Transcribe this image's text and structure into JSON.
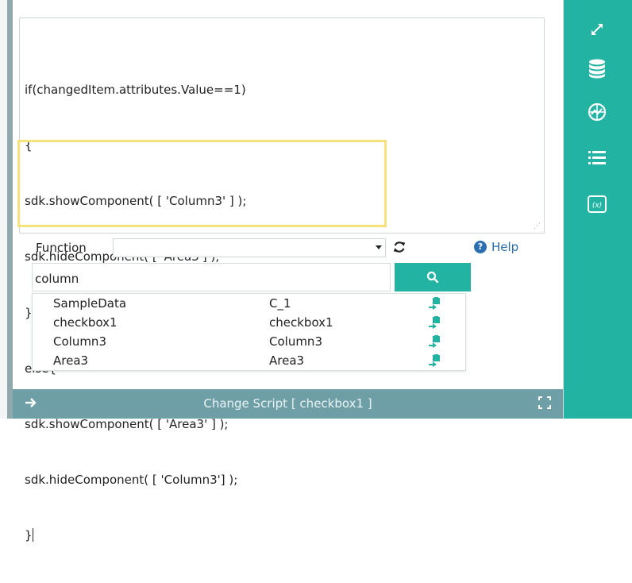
{
  "editor": {
    "code_lines": [
      "if(changedItem.attributes.Value==1)",
      "{",
      "sdk.showComponent( [ 'Column3' ] );",
      "sdk.hideComponent( [ 'Area3'] );",
      "}",
      "else{",
      "sdk.showComponent( [ 'Area3' ] );",
      "sdk.hideComponent( [ 'Column3'] );",
      "}"
    ]
  },
  "toolbar": {
    "function_label": "Function",
    "function_value": "",
    "help_label": "Help"
  },
  "search": {
    "value": "column"
  },
  "results": [
    {
      "name": "SampleData",
      "id": "C_1"
    },
    {
      "name": "checkbox1",
      "id": "checkbox1"
    },
    {
      "name": "Column3",
      "id": "Column3"
    },
    {
      "name": "Area3",
      "id": "Area3"
    }
  ],
  "footer": {
    "title": "Change Script [ checkbox1 ]"
  },
  "sidebar": {
    "icons": [
      "expand-icon",
      "database-icon",
      "dashboard-icon",
      "list-icon",
      "formula-icon"
    ]
  },
  "colors": {
    "accent": "#22b3a3",
    "footer": "#6f9fa6",
    "highlight": "#f7e27a",
    "help": "#2a6fb2"
  }
}
